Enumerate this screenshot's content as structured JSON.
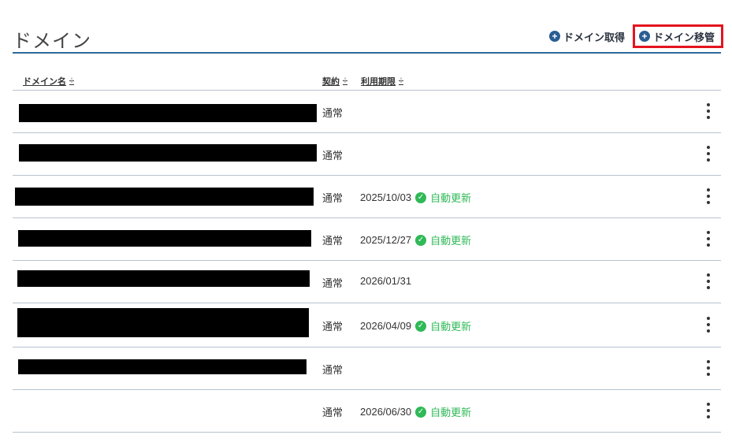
{
  "page": {
    "title": "ドメイン"
  },
  "actions": {
    "get_domain": {
      "icon": "plus-circle-icon",
      "label": "ドメイン取得"
    },
    "transfer_domain": {
      "icon": "plus-circle-icon",
      "label": "ドメイン移管",
      "highlight_color": "#e3141f"
    }
  },
  "table": {
    "columns": [
      {
        "label": "ドメイン名",
        "sortable": true
      },
      {
        "label": "契約",
        "sortable": true
      },
      {
        "label": "利用期限",
        "sortable": true
      }
    ],
    "rows": [
      {
        "domain": "",
        "contract": "通常",
        "expiry": "",
        "auto_renew": ""
      },
      {
        "domain": "",
        "contract": "通常",
        "expiry": "",
        "auto_renew": ""
      },
      {
        "domain": "",
        "contract": "通常",
        "expiry": "2025/10/03",
        "auto_renew": "自動更新"
      },
      {
        "domain": "",
        "contract": "通常",
        "expiry": "2025/12/27",
        "auto_renew": "自動更新"
      },
      {
        "domain": "",
        "contract": "通常",
        "expiry": "2026/01/31",
        "auto_renew": ""
      },
      {
        "domain": "",
        "contract": "通常",
        "expiry": "2026/04/09",
        "auto_renew": "自動更新"
      },
      {
        "domain": "",
        "contract": "通常",
        "expiry": "",
        "auto_renew": ""
      },
      {
        "domain": "",
        "contract": "通常",
        "expiry": "2026/06/30",
        "auto_renew": "自動更新"
      }
    ]
  },
  "colors": {
    "accent": "#2a5d93",
    "renew": "#2fb957",
    "divider": "#b7c3cf"
  }
}
